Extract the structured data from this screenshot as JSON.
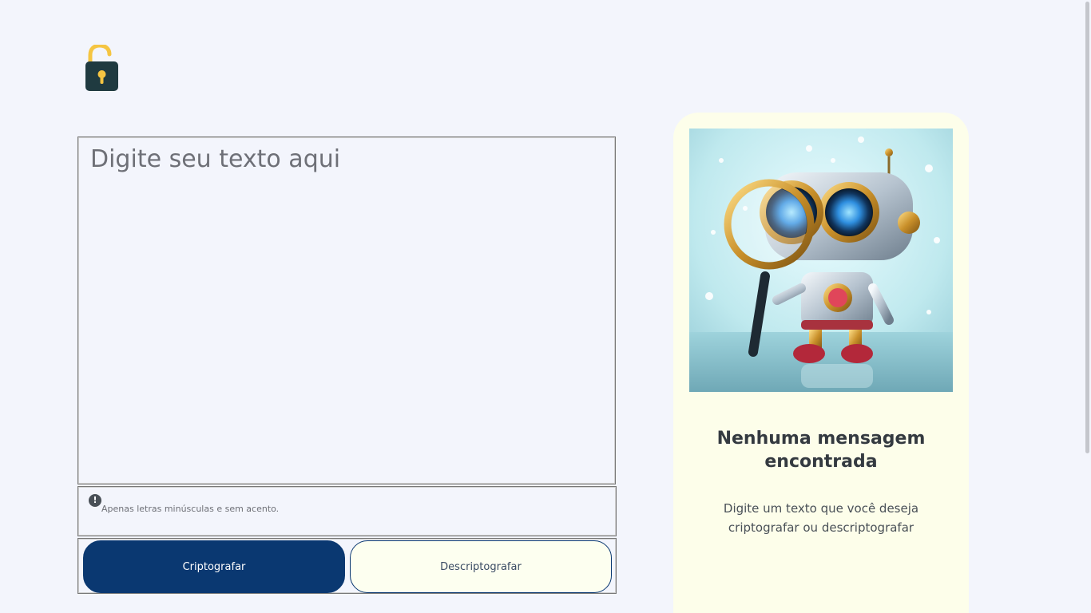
{
  "input": {
    "placeholder": "Digite seu texto aqui",
    "value": ""
  },
  "hint": {
    "icon": "exclamation-circle-icon",
    "text": "Apenas letras minúsculas e sem acento."
  },
  "buttons": {
    "encrypt_label": "Criptografar",
    "decrypt_label": "Descriptografar"
  },
  "result": {
    "title": "Nenhuma mensagem encontrada",
    "description": "Digite um texto que você deseja criptografar ou descriptografar"
  },
  "colors": {
    "background": "#f3f5fc",
    "primary": "#0a3871",
    "card": "#fdfeea",
    "lock_shackle": "#f5c542",
    "lock_body": "#1f3a40"
  }
}
